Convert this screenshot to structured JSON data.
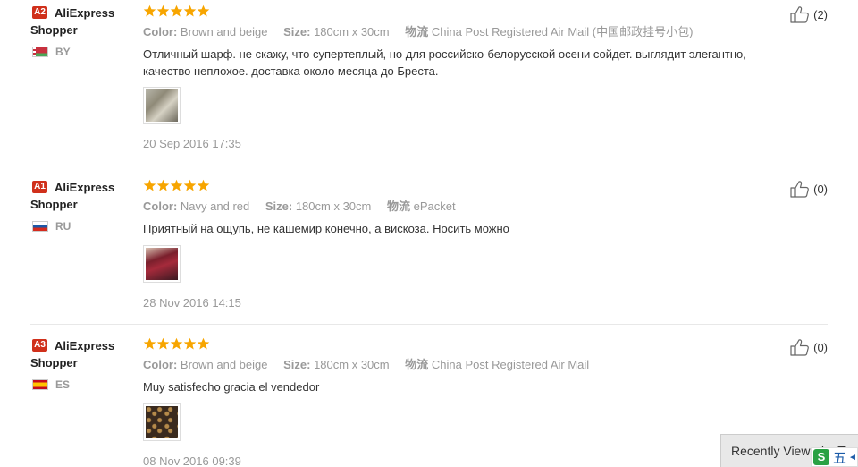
{
  "reviews": [
    {
      "level": "A2",
      "name": "AliExpress Shopper",
      "country": "BY",
      "stars": 5,
      "color_key": "Color:",
      "color_val": "Brown and beige",
      "size_key": "Size:",
      "size_val": "180cm x 30cm",
      "ship_key": "物流",
      "ship_val": "China Post Registered Air Mail (中国邮政挂号小包)",
      "text": "Отличный шарф. не скажу, что супертеплый, но для российско-белорусской осени сойдет. выглядит элегантно, качество неплохое. доставка около месяца до Бреста.",
      "date": "20 Sep 2016 17:35",
      "helpful": "(2)"
    },
    {
      "level": "A1",
      "name": "AliExpress Shopper",
      "country": "RU",
      "stars": 5,
      "color_key": "Color:",
      "color_val": "Navy and red",
      "size_key": "Size:",
      "size_val": "180cm x 30cm",
      "ship_key": "物流",
      "ship_val": "ePacket",
      "text": "Приятный на ощупь, не кашемир конечно, а вискоза. Носить можно",
      "date": "28 Nov 2016 14:15",
      "helpful": "(0)"
    },
    {
      "level": "A3",
      "name": "AliExpress Shopper",
      "country": "ES",
      "stars": 5,
      "color_key": "Color:",
      "color_val": "Brown and beige",
      "size_key": "Size:",
      "size_val": "180cm x 30cm",
      "ship_key": "物流",
      "ship_val": "China Post Registered Air Mail",
      "text": "Muy satisfecho gracia el vendedor",
      "date": "08 Nov 2016 09:39",
      "helpful": "(0)"
    }
  ],
  "recently_viewed": "Recently Viewed",
  "ime": {
    "s": "S",
    "mode": "五"
  },
  "colors": {
    "star": "#f7a500",
    "badge": "#d0301b",
    "muted": "#999999"
  }
}
